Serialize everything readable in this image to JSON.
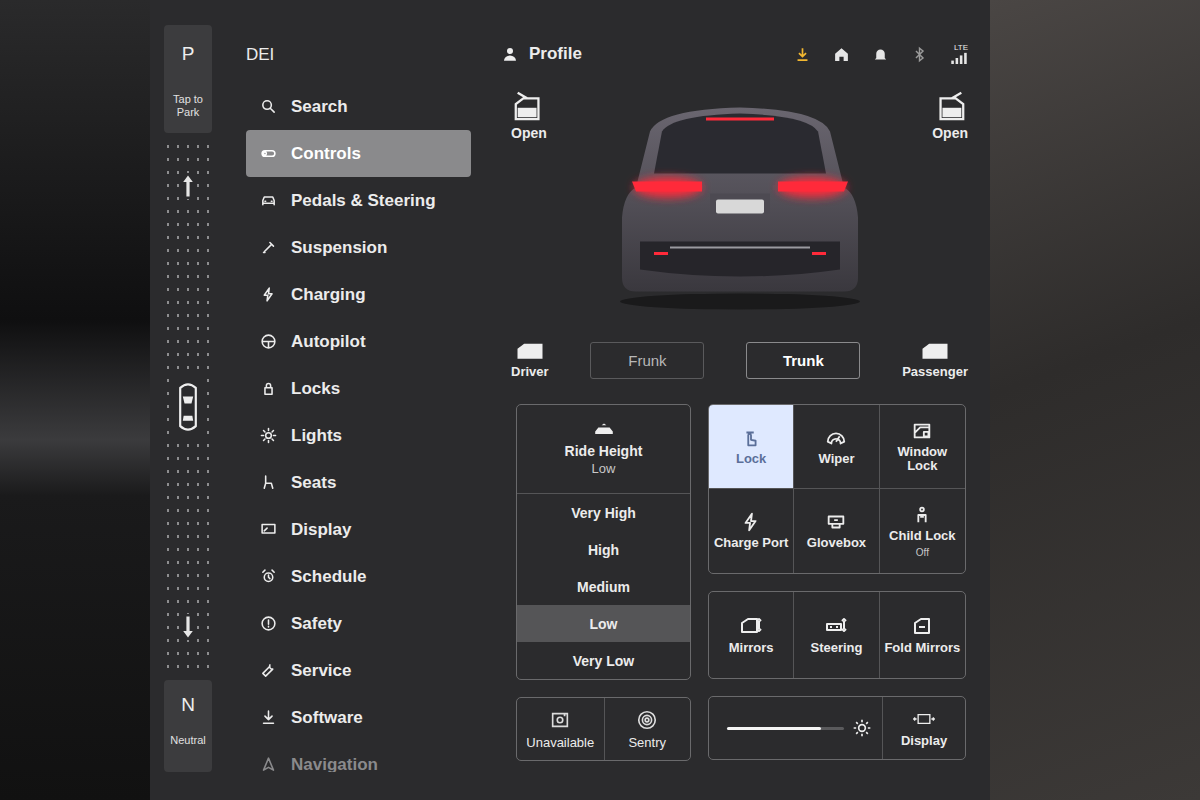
{
  "gear": {
    "park": {
      "label": "P",
      "hint": "Tap to Park"
    },
    "neutral": {
      "label": "N",
      "hint": "Neutral"
    }
  },
  "sidebar": {
    "title": "DEI",
    "items": [
      {
        "label": "Search",
        "selected": false,
        "faded": false
      },
      {
        "label": "Controls",
        "selected": true,
        "faded": false
      },
      {
        "label": "Pedals & Steering",
        "selected": false,
        "faded": false
      },
      {
        "label": "Suspension",
        "selected": false,
        "faded": false
      },
      {
        "label": "Charging",
        "selected": false,
        "faded": false
      },
      {
        "label": "Autopilot",
        "selected": false,
        "faded": false
      },
      {
        "label": "Locks",
        "selected": false,
        "faded": false
      },
      {
        "label": "Lights",
        "selected": false,
        "faded": false
      },
      {
        "label": "Seats",
        "selected": false,
        "faded": false
      },
      {
        "label": "Display",
        "selected": false,
        "faded": false
      },
      {
        "label": "Schedule",
        "selected": false,
        "faded": false
      },
      {
        "label": "Safety",
        "selected": false,
        "faded": false
      },
      {
        "label": "Service",
        "selected": false,
        "faded": false
      },
      {
        "label": "Software",
        "selected": false,
        "faded": false
      },
      {
        "label": "Navigation",
        "selected": false,
        "faded": true
      }
    ]
  },
  "top_bar": {
    "profile": "Profile",
    "download_pending": true,
    "network": "LTE"
  },
  "vehicle": {
    "left_door": "Open",
    "right_door": "Open",
    "tail_lights_on": true
  },
  "closures": [
    {
      "label": "Driver",
      "kind": "icon",
      "active": false
    },
    {
      "label": "Frunk",
      "kind": "button",
      "active": false
    },
    {
      "label": "Trunk",
      "kind": "button",
      "active": true
    },
    {
      "label": "Passenger",
      "kind": "icon",
      "active": false
    }
  ],
  "ride_height": {
    "title": "Ride Height",
    "value": "Low",
    "options": [
      {
        "label": "Very High",
        "selected": false
      },
      {
        "label": "High",
        "selected": false
      },
      {
        "label": "Medium",
        "selected": false
      },
      {
        "label": "Low",
        "selected": true
      },
      {
        "label": "Very Low",
        "selected": false
      }
    ]
  },
  "quick_controls": [
    {
      "label": "Lock",
      "sub": "",
      "selected": true
    },
    {
      "label": "Wiper",
      "sub": "",
      "selected": false
    },
    {
      "label": "Window Lock",
      "sub": "",
      "selected": false
    },
    {
      "label": "Charge Port",
      "sub": "",
      "selected": false
    },
    {
      "label": "Glovebox",
      "sub": "",
      "selected": false
    },
    {
      "label": "Child Lock",
      "sub": "Off",
      "selected": false
    }
  ],
  "mirror_controls": [
    {
      "label": "Mirrors"
    },
    {
      "label": "Steering"
    },
    {
      "label": "Fold Mirrors"
    }
  ],
  "camera": [
    {
      "label": "Unavailable"
    },
    {
      "label": "Sentry"
    }
  ],
  "brightness": {
    "level": 0.8
  },
  "display_button": {
    "label": "Display"
  }
}
